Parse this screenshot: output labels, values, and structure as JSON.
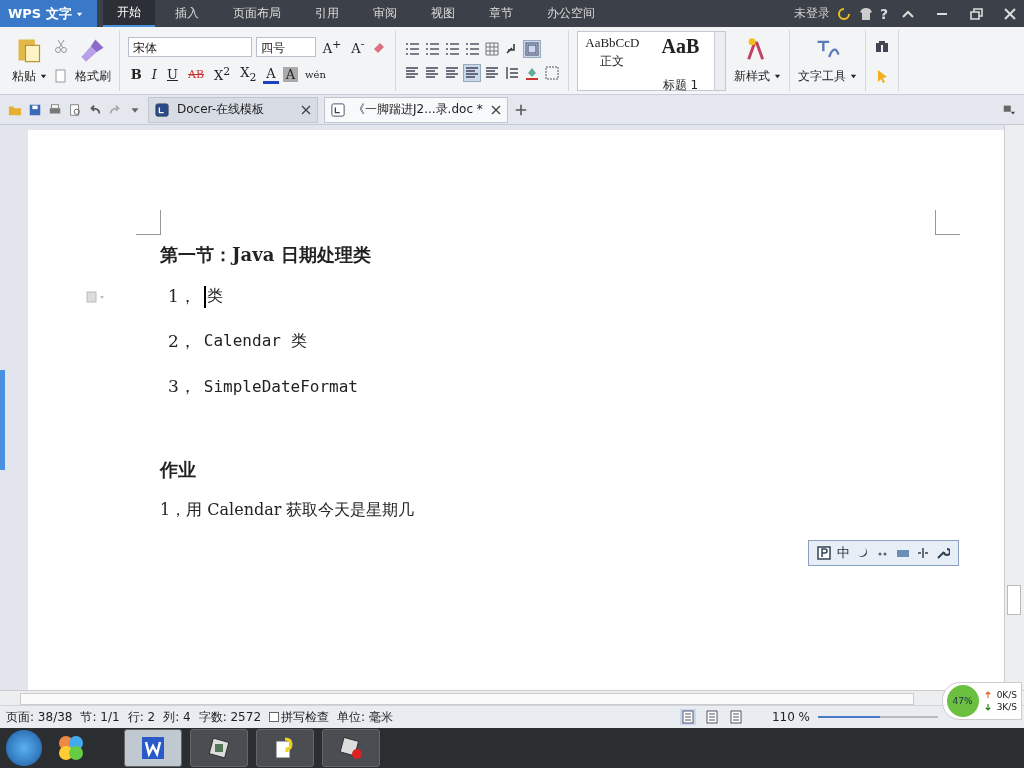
{
  "title_bar": {
    "app_menu": "WPS 文字",
    "tabs": [
      {
        "label": "开始",
        "selected": true
      },
      {
        "label": "插入",
        "selected": false
      },
      {
        "label": "页面布局",
        "selected": false
      },
      {
        "label": "引用",
        "selected": false
      },
      {
        "label": "审阅",
        "selected": false
      },
      {
        "label": "视图",
        "selected": false
      },
      {
        "label": "章节",
        "selected": false
      },
      {
        "label": "办公空间",
        "selected": false
      }
    ],
    "account": "未登录",
    "help": "?"
  },
  "ribbon": {
    "paste": "粘贴",
    "format_painter": "格式刷",
    "font_name": "宋体",
    "font_size": "四号",
    "size_buttons": [
      {
        "label": "A$^{+}$"
      },
      {
        "label": "A$^{-}$"
      }
    ],
    "font_buttons": [
      {
        "label": "B",
        "kind": "bold"
      },
      {
        "label": "I",
        "kind": "italic"
      },
      {
        "label": "U",
        "kind": "underline"
      },
      {
        "label": "AB",
        "kind": "strike"
      },
      {
        "label": "X$^{2}$",
        "kind": "plain"
      },
      {
        "label": "X$_{2}$",
        "kind": "plain"
      },
      {
        "label": "A",
        "kind": "color"
      },
      {
        "label": "A",
        "kind": "shade"
      },
      {
        "label": "wén",
        "kind": "ruby"
      }
    ],
    "align_buttons": [
      {
        "selected": false
      },
      {
        "selected": false
      },
      {
        "selected": false
      },
      {
        "selected": true
      },
      {
        "selected": false
      }
    ],
    "styles": [
      {
        "preview": "AaBbCcD",
        "label": "正文",
        "kind": "normal"
      },
      {
        "preview": "AaB",
        "label": "标题 1",
        "kind": "heading"
      }
    ],
    "new_style": "新样式",
    "text_tools": "文字工具"
  },
  "doc_tabs": [
    {
      "label": "Docer-在线模板",
      "selected": false
    },
    {
      "label": "《一脚踹进J2...录.doc *",
      "selected": true
    }
  ],
  "document": {
    "heading": "第一节：Java 日期处理类",
    "items": [
      {
        "number": "1，",
        "text": "类",
        "cursor": true
      },
      {
        "number": "2，",
        "text": "Calendar 类",
        "cursor": false
      },
      {
        "number": "3，",
        "text": "SimpleDateFormat",
        "cursor": false
      }
    ],
    "heading_2": "作业",
    "paragraph": "1，用 Calendar 获取今天是星期几"
  },
  "ime_bar": {
    "mode": "中"
  },
  "status_bar": {
    "fields": [
      "页面: 38/38",
      "节: 1/1",
      "行: 2",
      "列: 4",
      "字数: 2572"
    ],
    "spell_check": {
      "label": "拼写检查",
      "checked": false
    },
    "unit": "单位: 毫米",
    "views": [
      {
        "selected": true
      },
      {
        "selected": false
      },
      {
        "selected": false
      }
    ],
    "zoom": "110 %",
    "zoom_slider": {
      "level": 0.52
    }
  },
  "net_monitor": {
    "percent": "47%",
    "upload": "0K/S",
    "download": "3K/S"
  },
  "taskbar": {
    "apps": [
      {
        "kind": "wps",
        "selected": true
      },
      {
        "kind": "video",
        "selected": false
      },
      {
        "kind": "help",
        "selected": false
      },
      {
        "kind": "recorder",
        "selected": false
      }
    ]
  }
}
